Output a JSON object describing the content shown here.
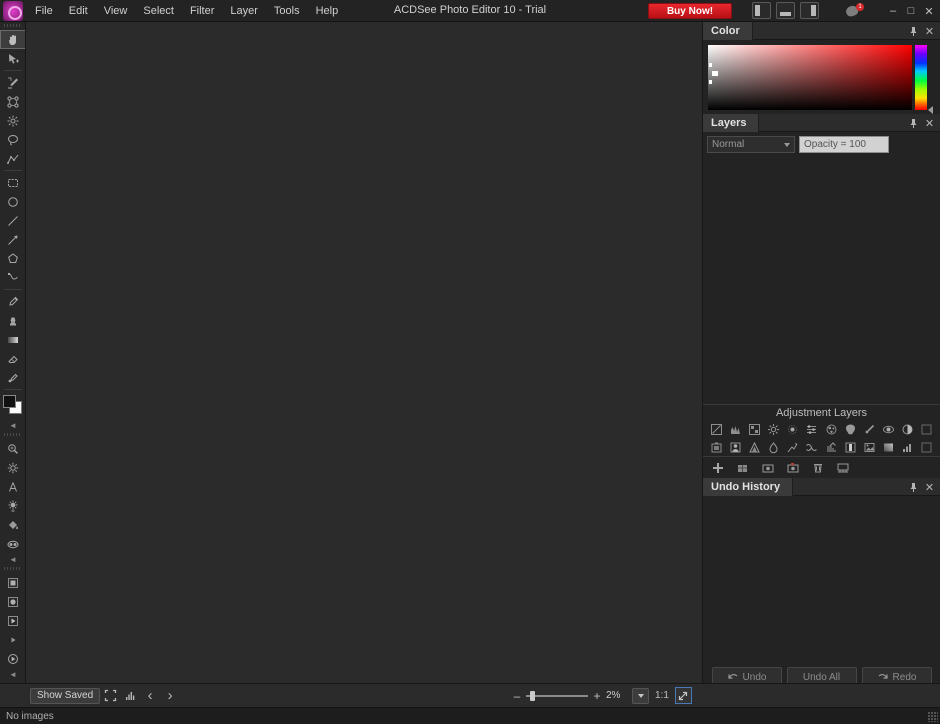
{
  "window": {
    "title": "ACDSee Photo Editor 10 - Trial",
    "logo_icon": "acdsee-logo-icon",
    "minimize_label": "–",
    "maximize_label": "□",
    "close_label": "✕"
  },
  "menubar": {
    "items": [
      {
        "label": "File",
        "name": "menu-file"
      },
      {
        "label": "Edit",
        "name": "menu-edit"
      },
      {
        "label": "View",
        "name": "menu-view"
      },
      {
        "label": "Select",
        "name": "menu-select"
      },
      {
        "label": "Filter",
        "name": "menu-filter"
      },
      {
        "label": "Layer",
        "name": "menu-layer"
      },
      {
        "label": "Tools",
        "name": "menu-tools"
      },
      {
        "label": "Help",
        "name": "menu-help"
      }
    ]
  },
  "buy_now": {
    "label": "Buy Now!",
    "color": "#d8232a"
  },
  "panel_toggles": [
    {
      "name": "toggle-left-panel-icon",
      "title": "Left Panel"
    },
    {
      "name": "toggle-bottom-panel-icon",
      "title": "Bottom Panel"
    },
    {
      "name": "toggle-right-panel-icon",
      "title": "Right Panel"
    }
  ],
  "notification": {
    "icon": "bell-icon",
    "count": "1"
  },
  "toolbar": {
    "tools": [
      {
        "name": "tool-hand",
        "icon": "hand-icon",
        "selected": true
      },
      {
        "name": "tool-select-move",
        "icon": "cursor-move-icon",
        "selected": false
      },
      {
        "name": "tool-brush",
        "icon": "brush-icon",
        "selected": false
      },
      {
        "name": "tool-smart-erase",
        "icon": "smart-erase-icon",
        "selected": false
      },
      {
        "name": "tool-magic-wand",
        "icon": "magic-wand-icon",
        "selected": false
      },
      {
        "name": "tool-lasso",
        "icon": "lasso-icon",
        "selected": false
      },
      {
        "name": "tool-polygon-lasso",
        "icon": "polygon-lasso-icon",
        "selected": false
      },
      {
        "name": "tool-rect-select",
        "icon": "rectangle-select-icon",
        "selected": false
      },
      {
        "name": "tool-ellipse-select",
        "icon": "ellipse-select-icon",
        "selected": false
      },
      {
        "name": "tool-line",
        "icon": "line-icon",
        "selected": false
      },
      {
        "name": "tool-arrow",
        "icon": "arrow-icon",
        "selected": false
      },
      {
        "name": "tool-polygon",
        "icon": "polygon-icon",
        "selected": false
      },
      {
        "name": "tool-curve",
        "icon": "curve-icon",
        "selected": false
      },
      {
        "name": "tool-eyedropper",
        "icon": "eyedropper-icon",
        "selected": false
      },
      {
        "name": "tool-clone-stamp",
        "icon": "clone-stamp-icon",
        "selected": false
      },
      {
        "name": "tool-gradient",
        "icon": "gradient-icon",
        "selected": false
      },
      {
        "name": "tool-eraser",
        "icon": "eraser-icon",
        "selected": false
      },
      {
        "name": "tool-blur",
        "icon": "blur-icon",
        "selected": false
      },
      {
        "name": "tool-repair",
        "icon": "repair-icon",
        "selected": false
      },
      {
        "name": "tool-dodge-burn",
        "icon": "dodge-burn-icon",
        "selected": false
      },
      {
        "name": "tool-text",
        "icon": "text-icon",
        "selected": false
      },
      {
        "name": "tool-sharpen",
        "icon": "sharpen-icon",
        "selected": false
      },
      {
        "name": "tool-fill",
        "icon": "paint-bucket-icon",
        "selected": false
      },
      {
        "name": "tool-red-eye",
        "icon": "red-eye-icon",
        "selected": false
      },
      {
        "name": "tool-square-shape",
        "icon": "square-shape-icon",
        "selected": false
      },
      {
        "name": "tool-circle-shape",
        "icon": "circle-shape-icon",
        "selected": false
      },
      {
        "name": "tool-play",
        "icon": "play-icon",
        "selected": false
      },
      {
        "name": "tool-record",
        "icon": "record-icon",
        "selected": false
      }
    ],
    "swatch_foreground": "#111111",
    "swatch_background": "#fafafa",
    "collapse_label": "◄"
  },
  "color_panel": {
    "title": "Color",
    "pin_icon": "pin-icon",
    "close_icon": "close-icon",
    "field_name": "saturation-value-field",
    "hue_name": "hue-strip"
  },
  "layers_panel": {
    "title": "Layers",
    "pin_icon": "pin-icon",
    "close_icon": "close-icon",
    "blend_mode": "Normal",
    "opacity": "Opacity = 100"
  },
  "adjustment_layers": {
    "title": "Adjustment Layers",
    "row1": [
      {
        "name": "adj-levels-icon",
        "title": "Levels"
      },
      {
        "name": "adj-histogram-icon",
        "title": "Auto Levels"
      },
      {
        "name": "adj-tone-curves-icon",
        "title": "Tone Curves"
      },
      {
        "name": "adj-light-eq-icon",
        "title": "Light EQ"
      },
      {
        "name": "adj-exposure-icon",
        "title": "Exposure"
      },
      {
        "name": "adj-color-balance-icon",
        "title": "Color Balance"
      },
      {
        "name": "adj-color-eq-icon",
        "title": "Color EQ"
      },
      {
        "name": "adj-white-balance-icon",
        "title": "White Balance"
      },
      {
        "name": "adj-dehaze-icon",
        "title": "Dehaze"
      },
      {
        "name": "adj-contrast-icon",
        "title": "Contrast"
      },
      {
        "name": "adj-invert-icon",
        "title": "Invert"
      }
    ],
    "row2": [
      {
        "name": "adj-vignette-icon",
        "title": "Vignette"
      },
      {
        "name": "adj-portrait-icon",
        "title": "Skin Tune"
      },
      {
        "name": "adj-noise-icon",
        "title": "Noise"
      },
      {
        "name": "adj-blur-icon",
        "title": "Blur"
      },
      {
        "name": "adj-clarity-icon",
        "title": "Clarity"
      },
      {
        "name": "adj-split-tone-icon",
        "title": "Split Tone"
      },
      {
        "name": "adj-detail-icon",
        "title": "Detail"
      },
      {
        "name": "adj-bw-icon",
        "title": "Black & White"
      },
      {
        "name": "adj-sepia-icon",
        "title": "Sepia"
      },
      {
        "name": "adj-gradient-icon",
        "title": "Gradient Map"
      },
      {
        "name": "adj-curves-icon",
        "title": "Channel Mixer"
      }
    ],
    "actions": [
      {
        "name": "add-layer-button",
        "icon": "plus-icon"
      },
      {
        "name": "duplicate-layer-button",
        "icon": "duplicate-icon"
      },
      {
        "name": "layer-mask-button",
        "icon": "mask-icon"
      },
      {
        "name": "snapshot-button",
        "icon": "camera-icon"
      },
      {
        "name": "delete-layer-button",
        "icon": "trash-icon"
      },
      {
        "name": "merge-layer-button",
        "icon": "merge-icon"
      }
    ]
  },
  "undo_history": {
    "title": "Undo History",
    "pin_icon": "pin-icon",
    "close_icon": "close-icon",
    "undo_label": "Undo",
    "undo_all_label": "Undo All",
    "redo_label": "Redo",
    "undo_icon": "undo-arrow-icon",
    "redo_icon": "redo-arrow-icon"
  },
  "statusbar": {
    "show_saved_label": "Show Saved",
    "fullscreen_icon": "fullscreen-icon",
    "histogram_icon": "histogram-icon",
    "prev_label": "‹",
    "next_label": "›",
    "zoom_minus": "–",
    "zoom_plus": "+",
    "zoom_value": "2%",
    "ratio_label": "1:1",
    "fit_icon": "fit-to-window-icon"
  },
  "footer": {
    "message": "No images"
  }
}
